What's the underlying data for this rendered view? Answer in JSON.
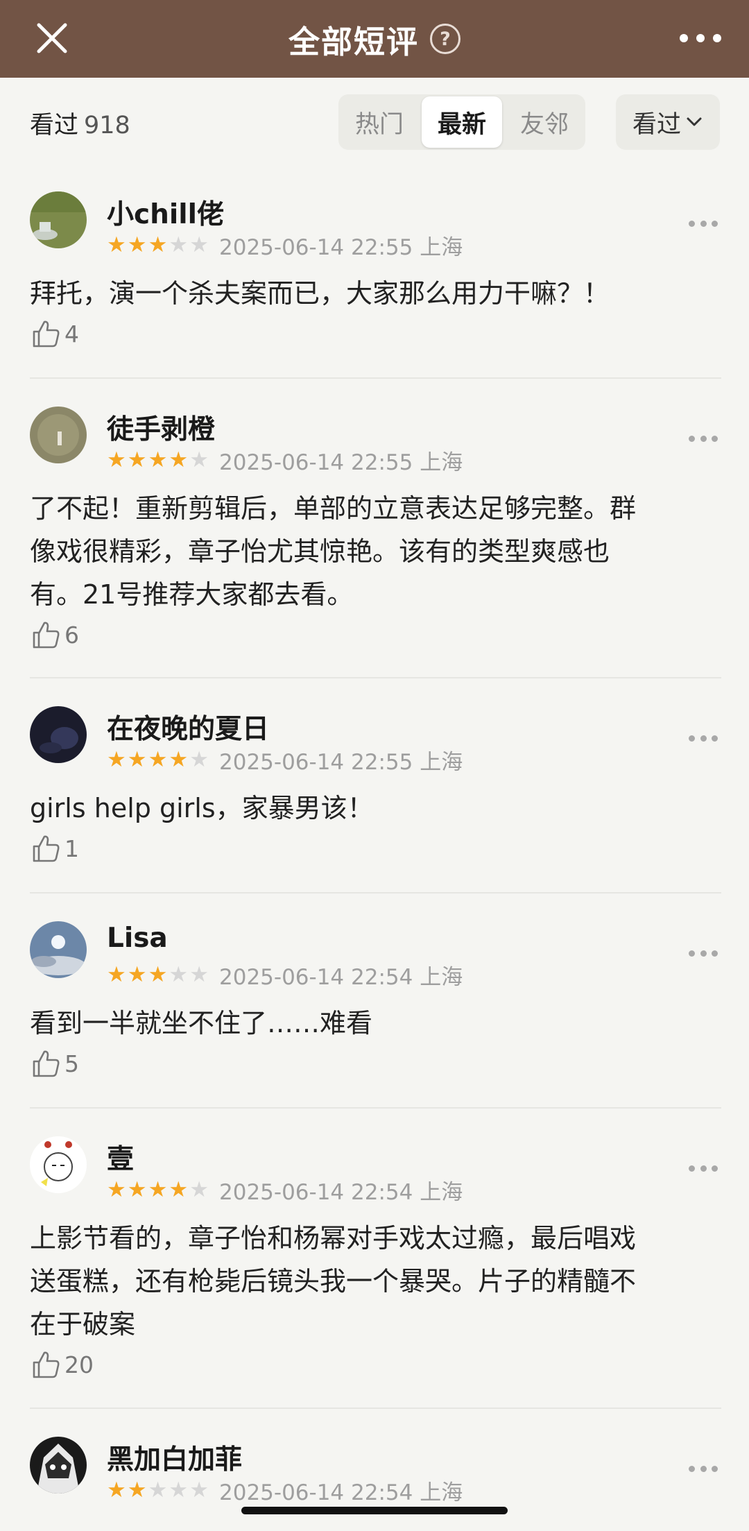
{
  "header": {
    "title": "全部短评",
    "help_icon_text": "?",
    "close_icon": "close-icon",
    "more_icon": "more-horizontal-icon",
    "background": "#725445"
  },
  "filter": {
    "label": "看过",
    "count": "918",
    "tabs": [
      "热门",
      "最新",
      "友邻"
    ],
    "active_tab": "最新",
    "status_select": "看过"
  },
  "colors": {
    "star_on": "#f5a623",
    "star_off": "#d6d6d6",
    "accent": "#725445"
  },
  "reviews": [
    {
      "user": "小chill佬",
      "rating": 3,
      "time": "2025-06-14 22:55",
      "location": "上海",
      "lines": [
        "拜托，演一个杀夫案而已，大家那么用力干嘛？！"
      ],
      "likes": "4"
    },
    {
      "user": "徒手剥橙",
      "rating": 4,
      "time": "2025-06-14 22:55",
      "location": "上海",
      "lines": [
        "了不起！重新剪辑后，单部的立意表达足够完整。群",
        "像戏很精彩，章子怡尤其惊艳。该有的类型爽感也",
        "有。21号推荐大家都去看。"
      ],
      "likes": "6"
    },
    {
      "user": "在夜晚的夏日",
      "rating": 4,
      "time": "2025-06-14 22:55",
      "location": "上海",
      "lines": [
        "girls help girls，家暴男该！"
      ],
      "likes": "1"
    },
    {
      "user": "Lisa",
      "rating": 3,
      "time": "2025-06-14 22:54",
      "location": "上海",
      "lines": [
        "看到一半就坐不住了……难看"
      ],
      "likes": "5"
    },
    {
      "user": "壹",
      "rating": 4,
      "time": "2025-06-14 22:54",
      "location": "上海",
      "lines": [
        "上影节看的，章子怡和杨幂对手戏太过瘾，最后唱戏",
        "送蛋糕，还有枪毙后镜头我一个暴哭。片子的精髓不",
        "在于破案"
      ],
      "likes": "20"
    },
    {
      "user": "黑加白加菲",
      "rating": 2,
      "time": "2025-06-14 22:54",
      "location": "上海",
      "lines": [],
      "likes": ""
    }
  ]
}
